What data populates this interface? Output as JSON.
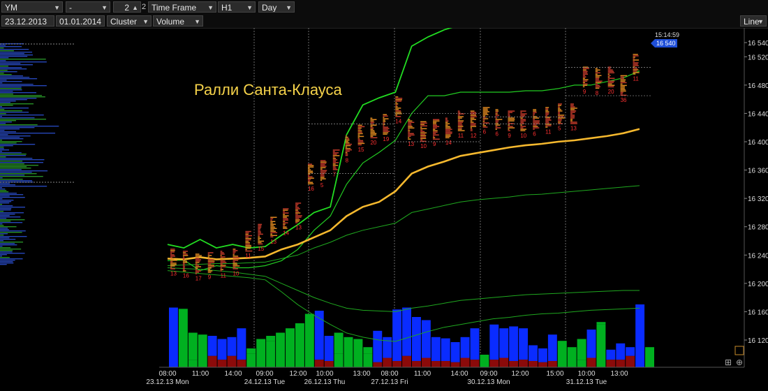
{
  "toolbar": {
    "symbol": "YM",
    "dash": "-",
    "period_value": "2",
    "period_suffix": "2",
    "timeframe_label": "Time Frame",
    "timeframe": "H1",
    "profile_period": "Day",
    "date_from": "23.12.2013",
    "date_to": "01.01.2014",
    "chart_type": "Cluster",
    "cluster_mode": "Volume",
    "scale_mode": "Line"
  },
  "annotation": "Ралли Санта-Клауса",
  "clock": "15:14:59",
  "colors": {
    "price_band": "#22dd22",
    "vwap": "#f5b82e",
    "vol_up": "#00b020",
    "vol_dn": "#0a2cff",
    "vol_neutral": "#8b0a0a",
    "price_tag": "#1f4fd8"
  },
  "chart_data": {
    "type": "line",
    "y_ticks": [
      16540,
      16520,
      16480,
      16440,
      16400,
      16360,
      16320,
      16280,
      16240,
      16200,
      16160,
      16120
    ],
    "ylim": [
      16100,
      16560
    ],
    "current_price": "16 540",
    "x_ticks": [
      {
        "time": "08:00",
        "date": "23.12.13 Mon"
      },
      {
        "time": "11:00",
        "date": ""
      },
      {
        "time": "14:00",
        "date": ""
      },
      {
        "time": "09:00",
        "date": "24.12.13 Tue"
      },
      {
        "time": "12:00",
        "date": ""
      },
      {
        "time": "10:00",
        "date": "26.12.13 Thu"
      },
      {
        "time": "13:00",
        "date": ""
      },
      {
        "time": "08:00",
        "date": "27.12.13 Fri"
      },
      {
        "time": "11:00",
        "date": ""
      },
      {
        "time": "14:00",
        "date": ""
      },
      {
        "time": "09:00",
        "date": "30.12.13 Mon"
      },
      {
        "time": "12:00",
        "date": ""
      },
      {
        "time": "15:00",
        "date": ""
      },
      {
        "time": "10:00",
        "date": "31.12.13 Tue"
      },
      {
        "time": "13:00",
        "date": ""
      }
    ],
    "cluster_labels": [
      "13",
      "16",
      "17",
      "9",
      "11",
      "10",
      "11",
      "15",
      "13",
      "14",
      "13",
      "16",
      "5",
      "7",
      "8",
      "15",
      "20",
      "19",
      "14",
      "13",
      "10",
      "9",
      "14",
      "11",
      "12",
      "6",
      "6",
      "9",
      "10",
      "6",
      "11",
      "5",
      "13",
      "9",
      "8",
      "20",
      "36",
      "11"
    ],
    "price_upper": [
      16255,
      16250,
      16262,
      16250,
      16255,
      16250,
      16252,
      16268,
      16283,
      16300,
      16308,
      16410,
      16452,
      16462,
      16470,
      16535,
      16548,
      16558,
      16565,
      16570,
      16575,
      16578,
      16584,
      16590,
      16600,
      16606,
      16612,
      16622,
      16632,
      16658
    ],
    "price_lower": [
      16232,
      16233,
      16218,
      16225,
      16222,
      16222,
      16225,
      16232,
      16248,
      16275,
      16295,
      16340,
      16370,
      16385,
      16402,
      16440,
      16465,
      16465,
      16470,
      16470,
      16470,
      16470,
      16472,
      16472,
      16475,
      16480,
      16480,
      16485,
      16490,
      16500
    ],
    "vwap": [
      16235,
      16234,
      16237,
      16234,
      16235,
      16236,
      16238,
      16248,
      16255,
      16265,
      16275,
      16295,
      16308,
      16315,
      16330,
      16355,
      16365,
      16372,
      16380,
      16384,
      16388,
      16392,
      16395,
      16397,
      16400,
      16402,
      16405,
      16408,
      16412,
      16418
    ],
    "band_up2": [
      16225,
      16226,
      16227,
      16228,
      16228,
      16229,
      16230,
      16235,
      16240,
      16250,
      16258,
      16268,
      16275,
      16280,
      16285,
      16300,
      16305,
      16310,
      16315,
      16318,
      16320,
      16322,
      16325,
      16326,
      16328,
      16330,
      16332,
      16334,
      16336,
      16338
    ],
    "band_lo1": [
      16222,
      16221,
      16220,
      16218,
      16216,
      16213,
      16210,
      16200,
      16190,
      16180,
      16172,
      16165,
      16162,
      16161,
      16160,
      16165,
      16168,
      16172,
      16176,
      16178,
      16180,
      16182,
      16184,
      16185,
      16186,
      16187,
      16188,
      16189,
      16190,
      16190
    ],
    "band_lo2": [
      16218,
      16216,
      16214,
      16212,
      16210,
      16208,
      16205,
      16188,
      16170,
      16155,
      16142,
      16130,
      16124,
      16120,
      16118,
      16125,
      16132,
      16138,
      16142,
      16146,
      16150,
      16152,
      16155,
      16157,
      16158,
      16160,
      16162,
      16163,
      16164,
      16165
    ],
    "volume_bars": [
      {
        "total": 0.95,
        "part": 0.0,
        "c": "dn"
      },
      {
        "total": 0.93,
        "part": 0.35,
        "c": "up"
      },
      {
        "total": 0.55,
        "part": 0.12,
        "c": "up"
      },
      {
        "total": 0.52,
        "part": 0.45,
        "c": "up"
      },
      {
        "total": 0.5,
        "part": 0.18,
        "c": "dn"
      },
      {
        "total": 0.45,
        "part": 0.12,
        "c": "dn"
      },
      {
        "total": 0.48,
        "part": 0.18,
        "c": "dn"
      },
      {
        "total": 0.62,
        "part": 0.12,
        "c": "dn"
      },
      {
        "total": 0.3,
        "part": 0.22,
        "c": "up"
      },
      {
        "total": 0.45,
        "part": 0.45,
        "c": "up"
      },
      {
        "total": 0.5,
        "part": 0.42,
        "c": "up"
      },
      {
        "total": 0.55,
        "part": 0.55,
        "c": "up"
      },
      {
        "total": 0.62,
        "part": 0.62,
        "c": "up"
      },
      {
        "total": 0.7,
        "part": 0.7,
        "c": "up"
      },
      {
        "total": 0.85,
        "part": 0.7,
        "c": "up"
      },
      {
        "total": 0.9,
        "part": 0.12,
        "c": "dn"
      },
      {
        "total": 0.5,
        "part": 0.1,
        "c": "dn"
      },
      {
        "total": 0.55,
        "part": 0.22,
        "c": "up"
      },
      {
        "total": 0.48,
        "part": 0.25,
        "c": "up"
      },
      {
        "total": 0.45,
        "part": 0.3,
        "c": "up"
      },
      {
        "total": 0.32,
        "part": 0.22,
        "c": "up"
      },
      {
        "total": 0.58,
        "part": 0.08,
        "c": "dn"
      },
      {
        "total": 0.48,
        "part": 0.15,
        "c": "dn"
      },
      {
        "total": 0.92,
        "part": 0.1,
        "c": "dn"
      },
      {
        "total": 0.95,
        "part": 0.18,
        "c": "dn"
      },
      {
        "total": 0.8,
        "part": 0.1,
        "c": "dn"
      },
      {
        "total": 0.75,
        "part": 0.15,
        "c": "dn"
      },
      {
        "total": 0.48,
        "part": 0.1,
        "c": "dn"
      },
      {
        "total": 0.46,
        "part": 0.1,
        "c": "dn"
      },
      {
        "total": 0.4,
        "part": 0.08,
        "c": "dn"
      },
      {
        "total": 0.48,
        "part": 0.15,
        "c": "dn"
      },
      {
        "total": 0.62,
        "part": 0.12,
        "c": "dn"
      },
      {
        "total": 0.2,
        "part": 0.1,
        "c": "up"
      },
      {
        "total": 0.68,
        "part": 0.12,
        "c": "dn"
      },
      {
        "total": 0.62,
        "part": 0.15,
        "c": "dn"
      },
      {
        "total": 0.65,
        "part": 0.1,
        "c": "dn"
      },
      {
        "total": 0.62,
        "part": 0.12,
        "c": "dn"
      },
      {
        "total": 0.35,
        "part": 0.1,
        "c": "dn"
      },
      {
        "total": 0.3,
        "part": 0.08,
        "c": "dn"
      },
      {
        "total": 0.52,
        "part": 0.1,
        "c": "dn"
      },
      {
        "total": 0.42,
        "part": 0.15,
        "c": "up"
      },
      {
        "total": 0.32,
        "part": 0.2,
        "c": "up"
      },
      {
        "total": 0.45,
        "part": 0.12,
        "c": "up"
      },
      {
        "total": 0.6,
        "part": 0.15,
        "c": "dn"
      },
      {
        "total": 0.72,
        "part": 0.68,
        "c": "up"
      },
      {
        "total": 0.28,
        "part": 0.12,
        "c": "dn"
      },
      {
        "total": 0.38,
        "part": 0.12,
        "c": "dn"
      },
      {
        "total": 0.32,
        "part": 0.18,
        "c": "dn"
      },
      {
        "total": 1.0,
        "part": 0.0,
        "c": "dn"
      },
      {
        "total": 0.32,
        "part": 0.3,
        "c": "up"
      }
    ]
  }
}
